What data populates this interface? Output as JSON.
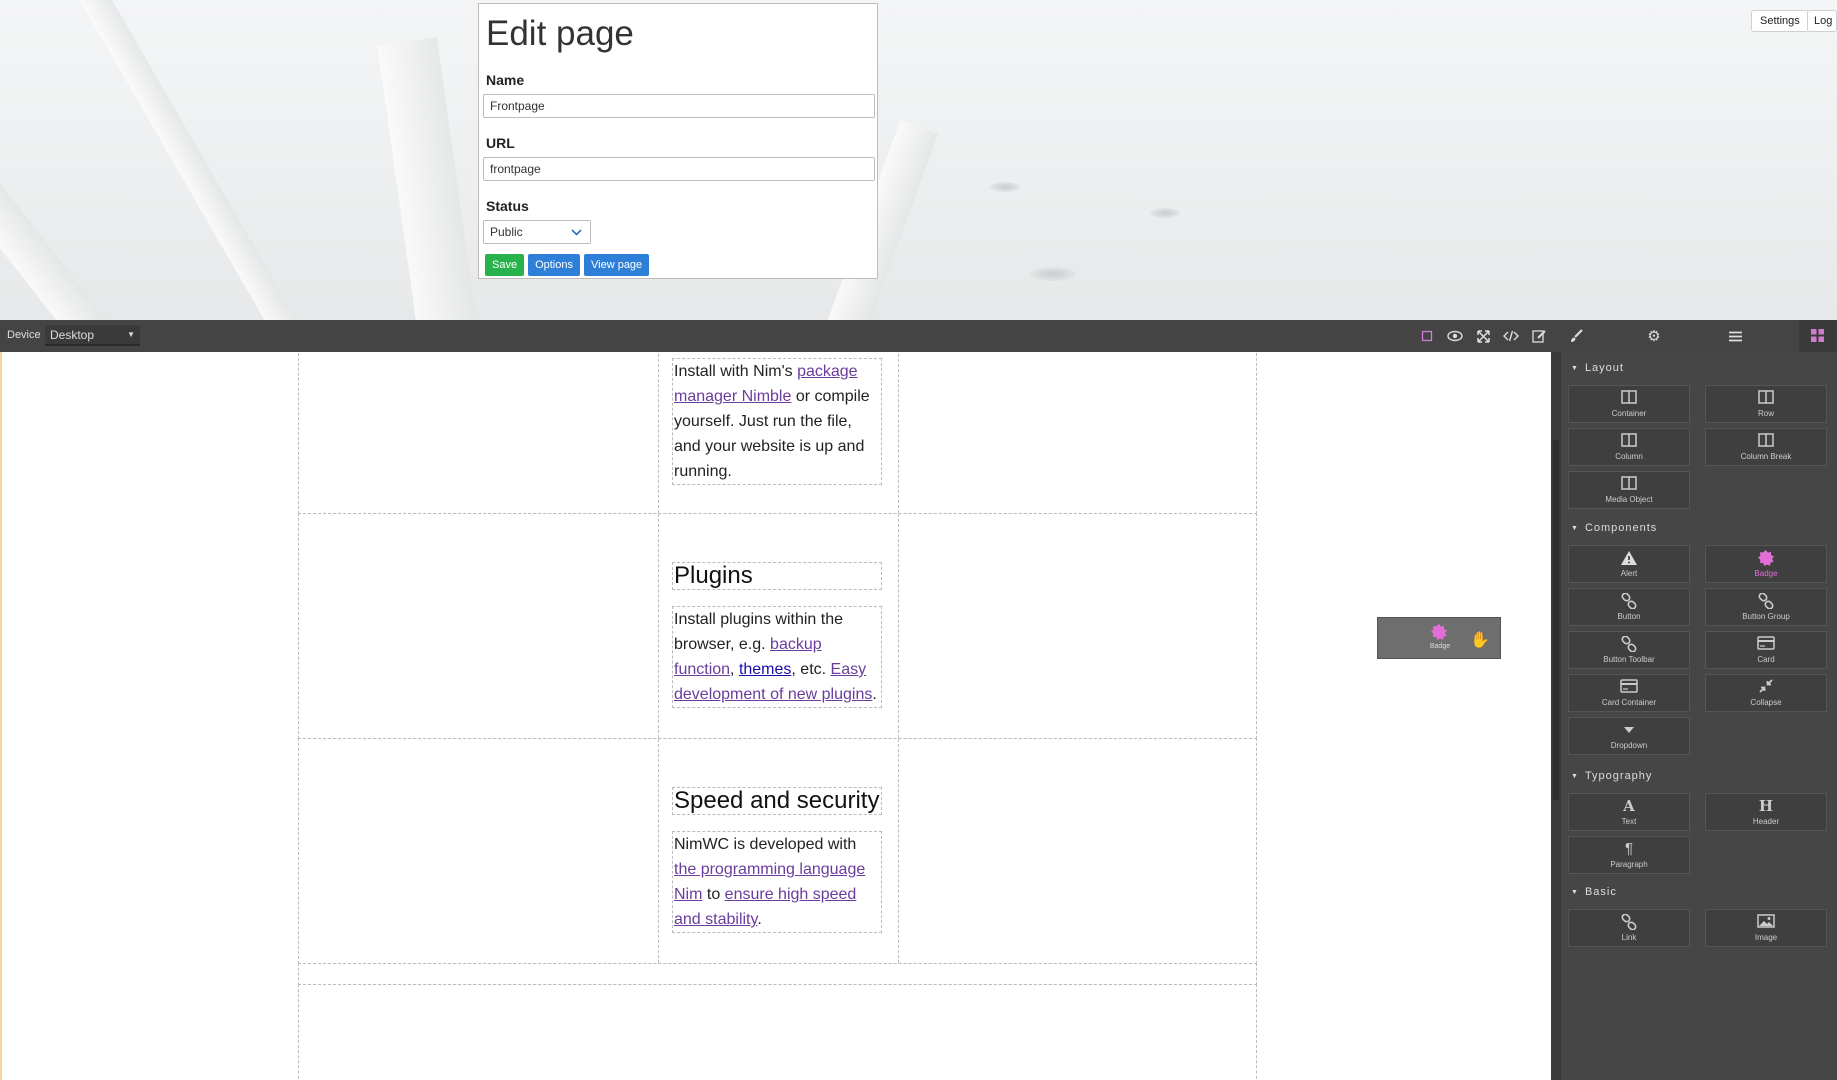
{
  "header": {
    "settings_label": "Settings",
    "logout_label": "Log"
  },
  "edit_page": {
    "title": "Edit page",
    "name_label": "Name",
    "name_value": "Frontpage",
    "url_label": "URL",
    "url_value": "frontpage",
    "status_label": "Status",
    "status_value": "Public",
    "save_label": "Save",
    "options_label": "Options",
    "view_label": "View page"
  },
  "toolbar": {
    "device_label": "Device",
    "device_value": "Desktop",
    "icons": [
      "sw-visibility-icon",
      "preview-icon",
      "fullscreen-icon",
      "code-icon",
      "edit-icon",
      "style-manager-icon",
      "settings-icon",
      "layer-manager-icon",
      "blocks-icon"
    ]
  },
  "canvas": {
    "block1": {
      "pre": "Install with Nim's ",
      "link1": "package manager Nimble",
      "post": " or compile yourself. Just run the file, and your website is up and running."
    },
    "plugins": {
      "heading": "Plugins",
      "pre": "Install plugins within the browser, e.g. ",
      "link1": "backup function",
      "sep1": ", ",
      "link2": "themes",
      "sep2": ", etc. ",
      "link3": "Easy development of new plugins",
      "end": "."
    },
    "speed": {
      "heading": "Speed and security",
      "pre": "NimWC is developed with ",
      "link1": "the programming language Nim",
      "mid": " to ",
      "link2": "ensure high speed and stability",
      "end": "."
    },
    "drag_ghost": {
      "label": "Badge"
    }
  },
  "blocks": {
    "categories": [
      {
        "name": "Layout",
        "items": [
          "Container",
          "Row",
          "Column",
          "Column Break",
          "Media Object"
        ]
      },
      {
        "name": "Components",
        "items": [
          "Alert",
          "Badge",
          "Button",
          "Button Group",
          "Button Toolbar",
          "Card",
          "Card Container",
          "Collapse",
          "Dropdown"
        ]
      },
      {
        "name": "Typography",
        "items": [
          "Text",
          "Header",
          "Paragraph"
        ]
      },
      {
        "name": "Basic",
        "items": [
          "Link",
          "Image"
        ]
      }
    ]
  },
  "colors": {
    "badge_accent": "#e46ed8",
    "save_green": "#28b24b",
    "button_blue": "#2d7fd8",
    "link_purple": "#6a3c9c"
  }
}
